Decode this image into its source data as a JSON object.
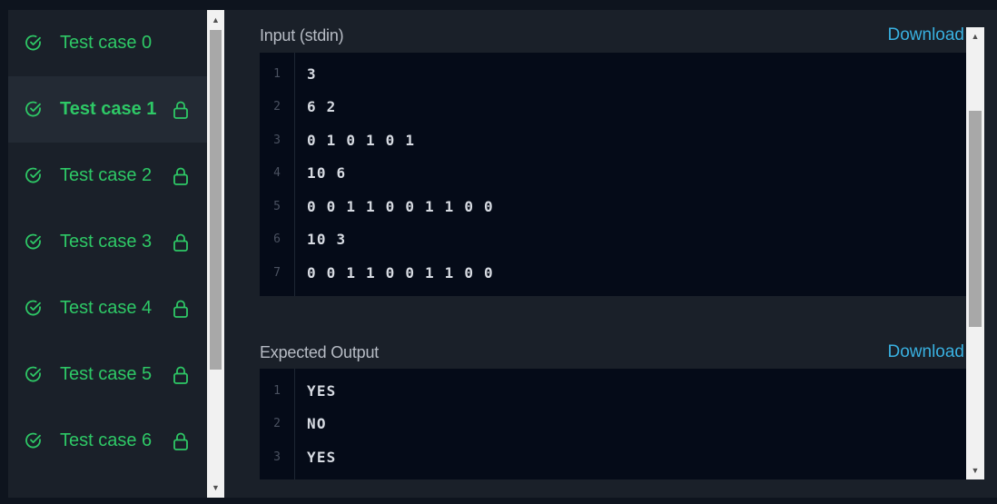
{
  "sidebar": {
    "items": [
      {
        "label": "Test case 0",
        "locked": false,
        "active": false
      },
      {
        "label": "Test case 1",
        "locked": true,
        "active": true
      },
      {
        "label": "Test case 2",
        "locked": true,
        "active": false
      },
      {
        "label": "Test case 3",
        "locked": true,
        "active": false
      },
      {
        "label": "Test case 4",
        "locked": true,
        "active": false
      },
      {
        "label": "Test case 5",
        "locked": true,
        "active": false
      },
      {
        "label": "Test case 6",
        "locked": true,
        "active": false
      }
    ]
  },
  "input_section": {
    "title": "Input (stdin)",
    "download_label": "Download",
    "lines": [
      {
        "num": "1",
        "text": "3"
      },
      {
        "num": "2",
        "text": "6 2"
      },
      {
        "num": "3",
        "text": "0 1 0 1 0 1"
      },
      {
        "num": "4",
        "text": "10 6"
      },
      {
        "num": "5",
        "text": "0 0 1 1 0 0 1 1 0 0"
      },
      {
        "num": "6",
        "text": "10 3"
      },
      {
        "num": "7",
        "text": "0 0 1 1 0 0 1 1 0 0"
      }
    ]
  },
  "output_section": {
    "title": "Expected Output",
    "download_label": "Download",
    "lines": [
      {
        "num": "1",
        "text": "YES"
      },
      {
        "num": "2",
        "text": "NO"
      },
      {
        "num": "3",
        "text": "YES"
      }
    ]
  },
  "colors": {
    "success": "#2ec866",
    "link": "#39b0e0",
    "panel_bg": "#1a2029",
    "code_bg": "#050b18",
    "page_bg": "#0e141e"
  },
  "icons": {
    "check": "check-circle-icon",
    "lock": "lock-icon",
    "scroll_up": "scroll-up-arrow-icon",
    "scroll_down": "scroll-down-arrow-icon"
  }
}
